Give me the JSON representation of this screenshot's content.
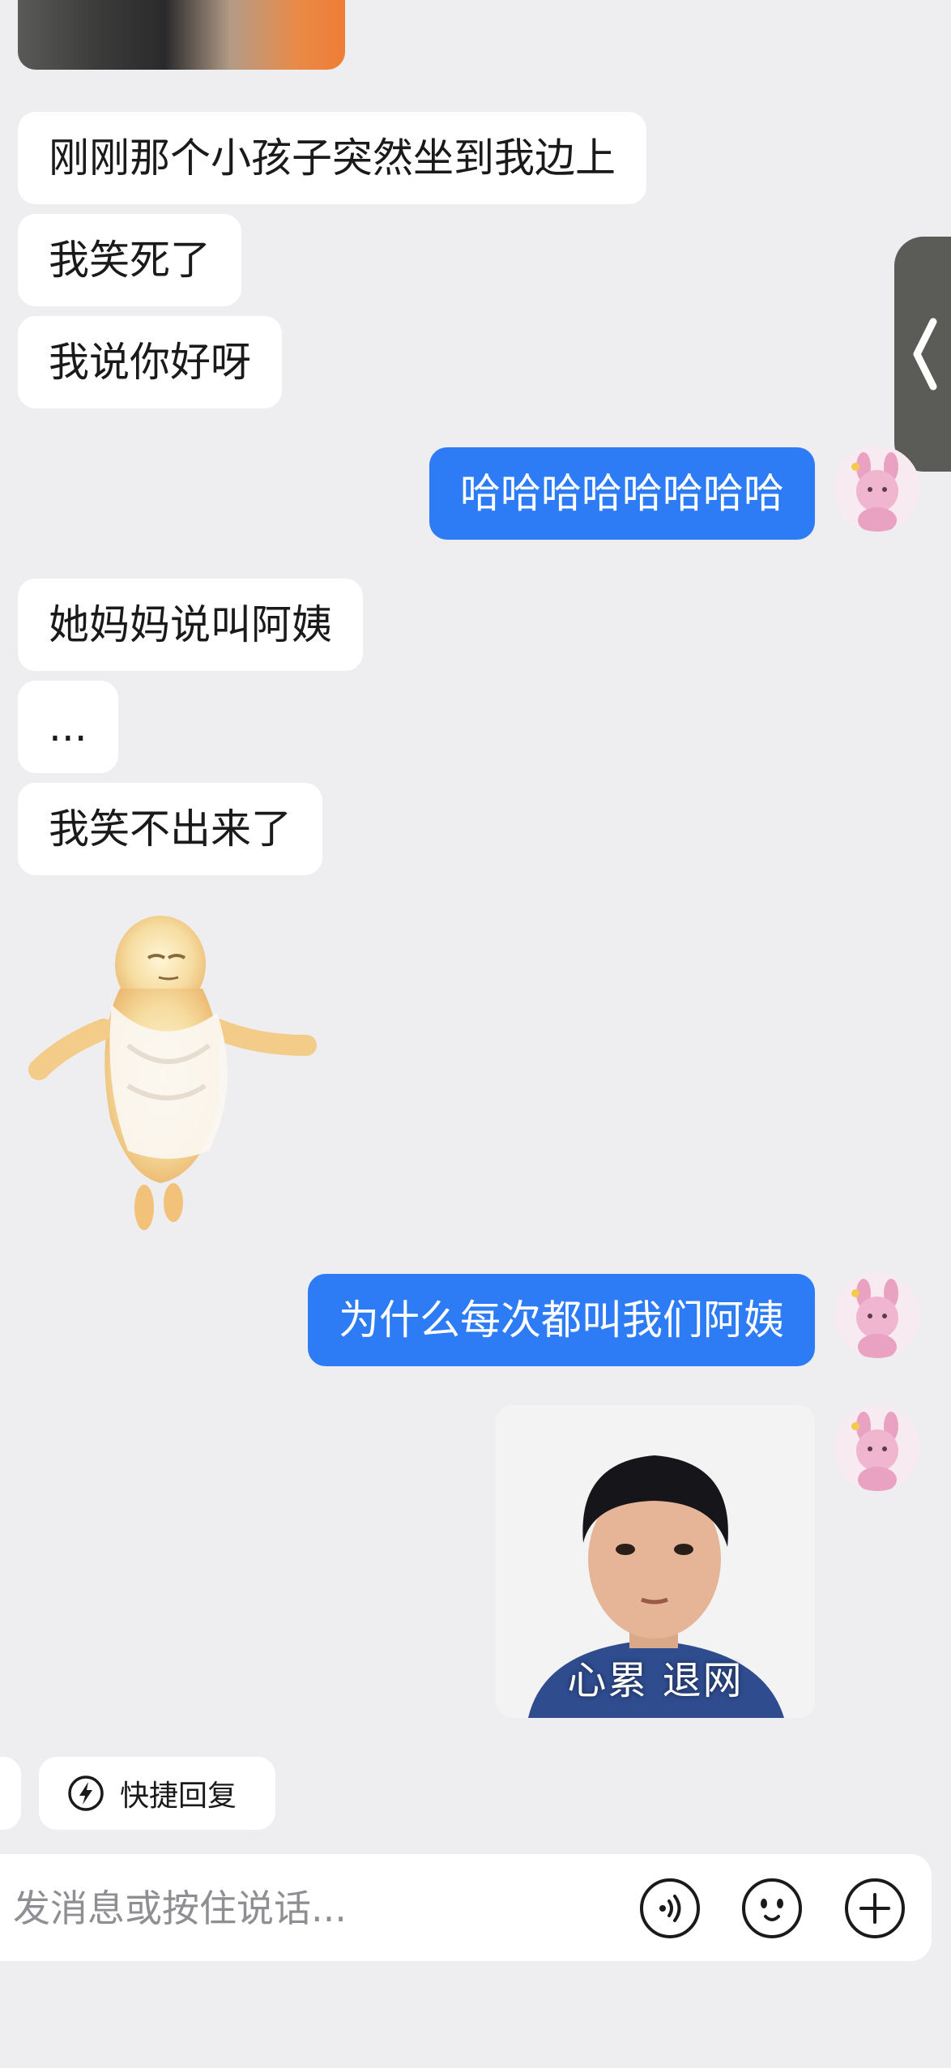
{
  "messages": {
    "m1": "刚刚那个小孩子突然坐到我边上",
    "m2": "我笑死了",
    "m3": "我说你好呀",
    "m4": "哈哈哈哈哈哈哈哈",
    "m5": "她妈妈说叫阿姨",
    "m6": "...",
    "m7": "我笑不出来了",
    "m8": "为什么每次都叫我们阿姨"
  },
  "meme": {
    "caption": "心累 退网"
  },
  "quick_reply": {
    "label": "快捷回复"
  },
  "input": {
    "placeholder": "发消息或按住说话..."
  },
  "colors": {
    "sent_bubble": "#2d7cf6",
    "received_bubble": "#ffffff",
    "background": "#eeeef0"
  },
  "icons": {
    "voice": "voice-wave-icon",
    "emoji": "emoji-face-icon",
    "plus": "plus-circle-icon",
    "quick_reply": "lightning-icon",
    "side_handle": "chevron-left-icon"
  }
}
